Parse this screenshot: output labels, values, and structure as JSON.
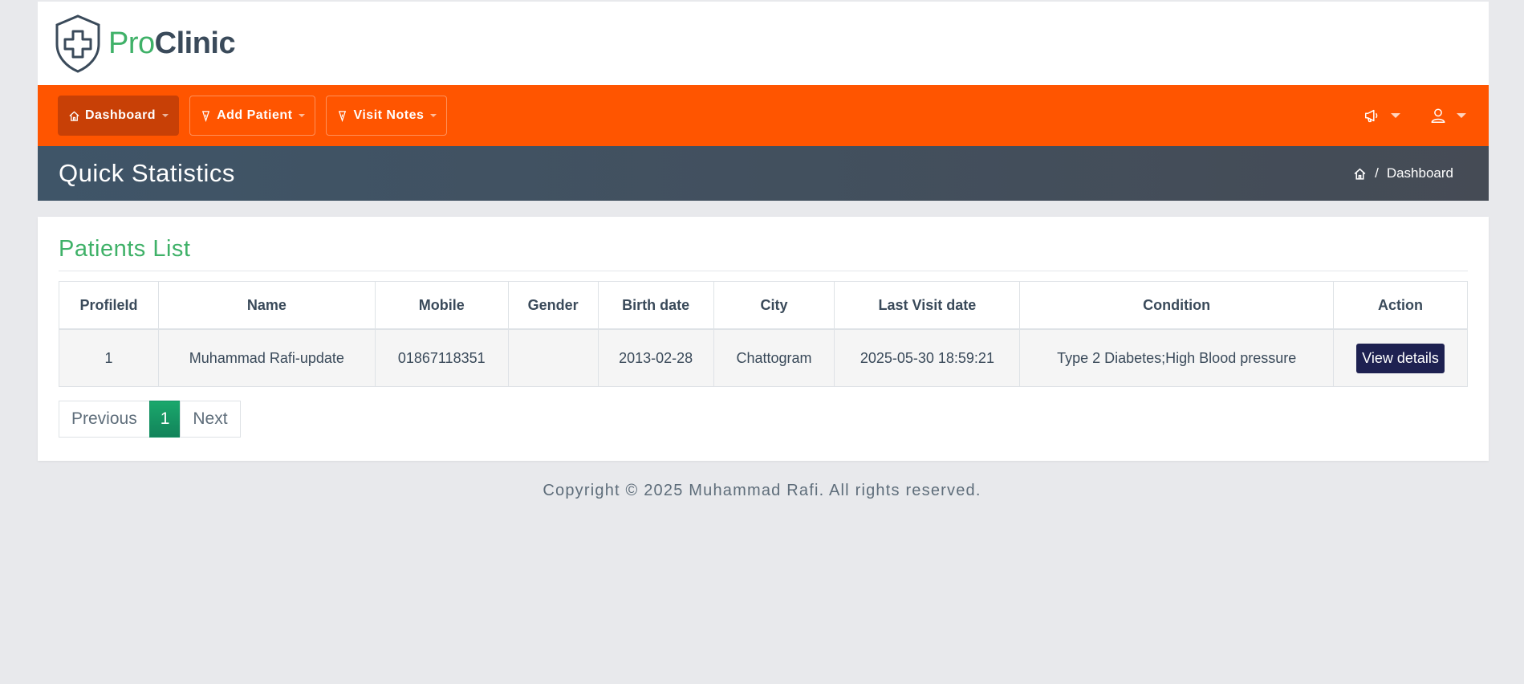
{
  "brand": {
    "name_pro": "Pro",
    "name_clinic": "Clinic"
  },
  "nav": {
    "items": [
      {
        "label": "Dashboard",
        "icon": "home-icon"
      },
      {
        "label": "Add Patient",
        "icon": "pin-icon"
      },
      {
        "label": "Visit Notes",
        "icon": "pin-icon"
      }
    ],
    "right_icons": [
      "megaphone-icon",
      "user-icon"
    ]
  },
  "title_bar": {
    "title": "Quick Statistics",
    "breadcrumb_separator": "/",
    "breadcrumb_current": "Dashboard"
  },
  "patients": {
    "title": "Patients List",
    "columns": [
      "ProfileId",
      "Name",
      "Mobile",
      "Gender",
      "Birth date",
      "City",
      "Last Visit date",
      "Condition",
      "Action"
    ],
    "rows": [
      {
        "profile_id": "1",
        "name": "Muhammad Rafi-update",
        "mobile": "01867118351",
        "gender": "",
        "birth_date": "2013-02-28",
        "city": "Chattogram",
        "last_visit": "2025-05-30 18:59:21",
        "condition": "Type 2 Diabetes;High Blood pressure",
        "action_label": "View details"
      }
    ]
  },
  "pagination": {
    "previous": "Previous",
    "current": "1",
    "next": "Next"
  },
  "footer": {
    "text": "Copyright © 2025 Muhammad Rafi. All rights reserved."
  },
  "colors": {
    "brand_green": "#3fb168",
    "navbar_orange": "#ff5500",
    "active_nav": "#c84006",
    "view_button": "#1e2151"
  }
}
